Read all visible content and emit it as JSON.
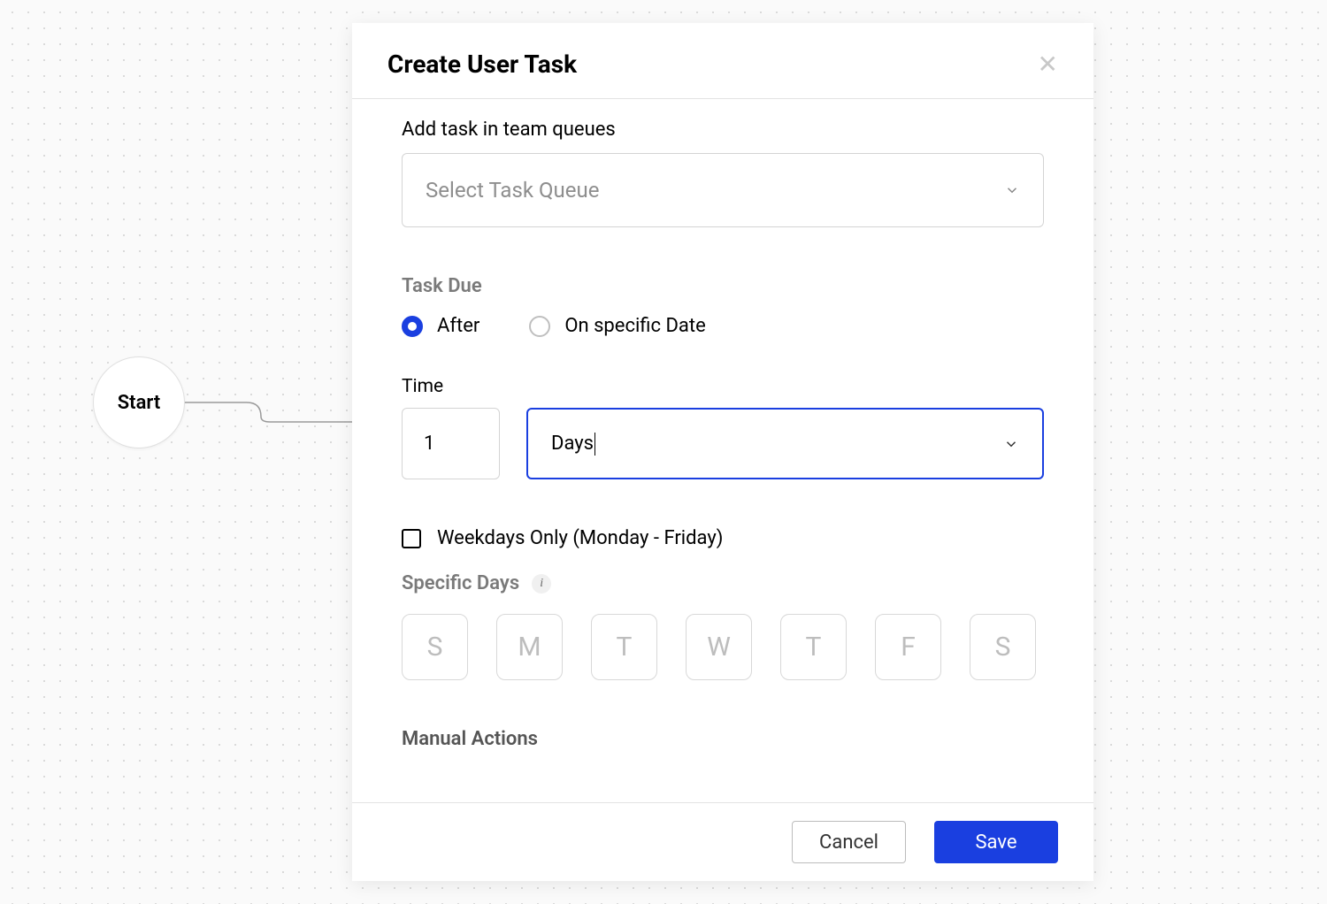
{
  "canvas": {
    "start_node_label": "Start"
  },
  "modal": {
    "title": "Create User Task",
    "team_queue": {
      "label": "Add task in team queues",
      "placeholder": "Select Task Queue"
    },
    "task_due": {
      "section_label": "Task Due",
      "options": [
        {
          "label": "After",
          "selected": true
        },
        {
          "label": "On specific Date",
          "selected": false
        }
      ]
    },
    "time": {
      "label": "Time",
      "value": "1",
      "unit": "Days"
    },
    "weekdays_only": {
      "label": "Weekdays Only (Monday - Friday)",
      "checked": false
    },
    "specific_days": {
      "label": "Specific Days",
      "days": [
        "S",
        "M",
        "T",
        "W",
        "T",
        "F",
        "S"
      ]
    },
    "manual_actions_label": "Manual Actions",
    "footer": {
      "cancel_label": "Cancel",
      "save_label": "Save"
    }
  },
  "colors": {
    "primary": "#1a3fe0"
  }
}
